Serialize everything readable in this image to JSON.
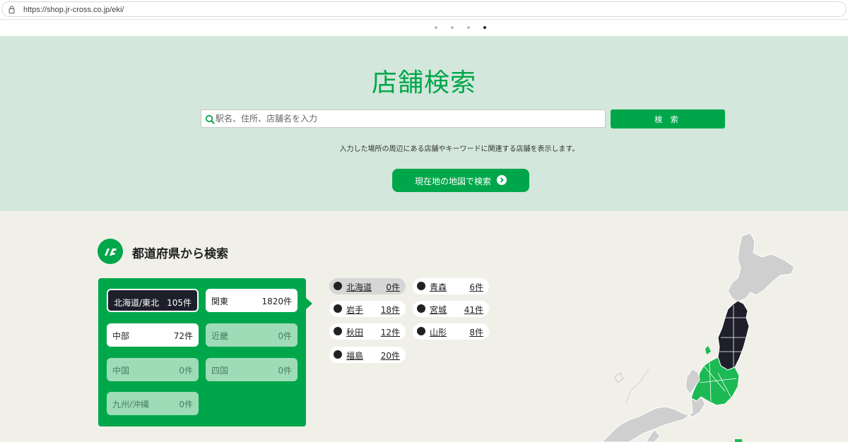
{
  "browser": {
    "url": "https://shop.jr-cross.co.jp/eki/"
  },
  "carousel": {
    "dots": 4,
    "active_index": 3
  },
  "hero": {
    "title": "店舗検索",
    "search_placeholder": "駅名、住所、店舗名を入力",
    "search_button": "検 索",
    "note": "入力した場所の周辺にある店舗やキーワードに関連する店舗を表示します。",
    "location_button": "現在地の地図で検索"
  },
  "prefecture_search": {
    "title": "都道府県から検索",
    "regions": [
      {
        "name": "北海道/東北",
        "count": "105件",
        "state": "selected"
      },
      {
        "name": "関東",
        "count": "1820件",
        "state": "on"
      },
      {
        "name": "中部",
        "count": "72件",
        "state": "on"
      },
      {
        "name": "近畿",
        "count": "0件",
        "state": "off"
      },
      {
        "name": "中国",
        "count": "0件",
        "state": "off"
      },
      {
        "name": "四国",
        "count": "0件",
        "state": "off"
      },
      {
        "name": "九州/沖縄",
        "count": "0件",
        "state": "off"
      }
    ],
    "prefectures": [
      {
        "name": "北海道",
        "count": "0件"
      },
      {
        "name": "青森",
        "count": "6件"
      },
      {
        "name": "岩手",
        "count": "18件"
      },
      {
        "name": "宮城",
        "count": "41件"
      },
      {
        "name": "秋田",
        "count": "12件"
      },
      {
        "name": "山形",
        "count": "8件"
      },
      {
        "name": "福島",
        "count": "20件"
      }
    ]
  },
  "colors": {
    "brand_green": "#00a74a",
    "hero_bg": "#d4e7dc",
    "page_bg": "#f1f0e8",
    "selected_dark": "#1e1f2b",
    "disabled_green": "#9edcb8",
    "map_gray": "#cfcfcf"
  }
}
